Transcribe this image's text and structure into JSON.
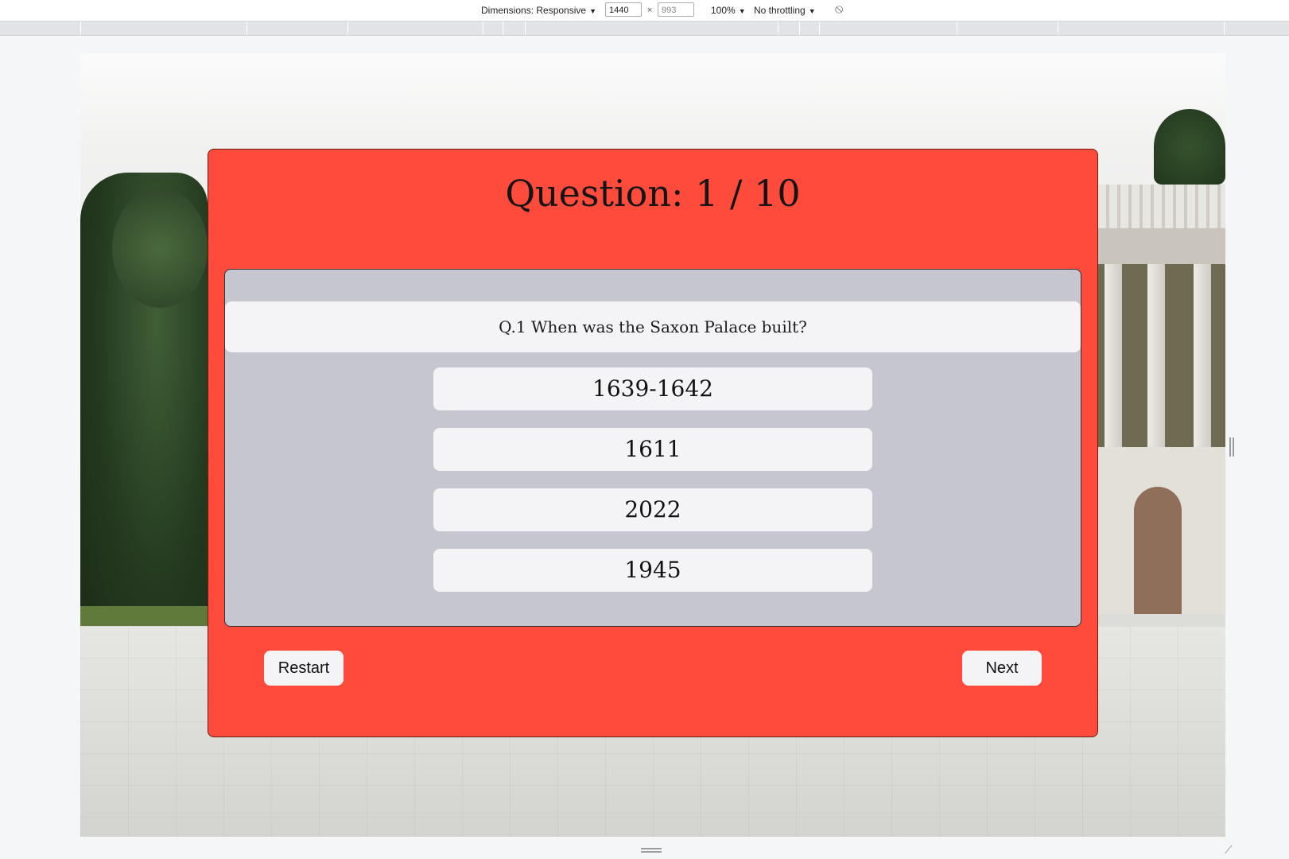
{
  "devtools": {
    "dimensions_label": "Dimensions: Responsive",
    "width_value": "1440",
    "times": "×",
    "height_value": "993",
    "zoom_label": "100%",
    "throttling_label": "No throttling",
    "dropdown_caret": "▼",
    "rotate_glyph": "⦸"
  },
  "quiz": {
    "title": "Question: 1 / 10",
    "question": "Q.1 When was the Saxon Palace built?",
    "options": [
      "1639-1642",
      "1611",
      "2022",
      "1945"
    ],
    "restart_label": "Restart",
    "next_label": "Next"
  },
  "colors": {
    "card": "#ff4b3c",
    "question_panel": "#c6c6d0",
    "option_bg": "#f4f4f6"
  }
}
